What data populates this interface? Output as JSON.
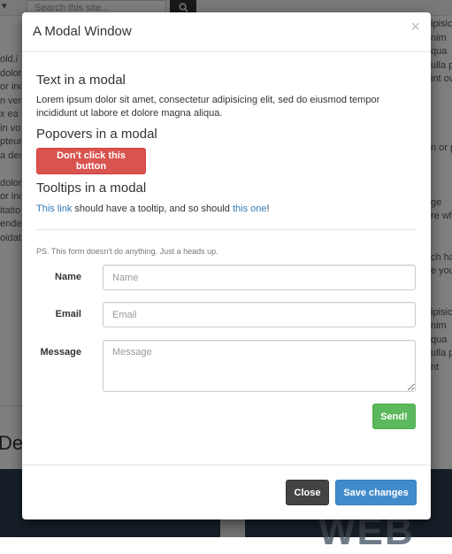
{
  "background": {
    "dropdown_caret": "▾",
    "search_placeholder": "Search this site...",
    "search_icon": "search-icon",
    "left_fragments": [
      "dolor",
      "or inc",
      "n veni",
      "x ea",
      "in vol",
      "pteur",
      "a des",
      "",
      "dolor",
      "or inc",
      "itatio",
      "ender",
      "oidat"
    ],
    "left_label": "old.i",
    "right_fragments": [
      "ipisic",
      "nim",
      "qua",
      "ulla p",
      "int ov",
      "",
      "",
      "",
      "",
      "n or p",
      "",
      "",
      "",
      "ge",
      "re whi",
      "",
      "",
      "ch hav",
      "e you",
      "",
      "",
      "ipisic",
      "nim",
      "qua",
      "ulla p",
      "nt"
    ],
    "desc_heading": "Des",
    "banner_text": "WEB"
  },
  "modal": {
    "title": "A Modal Window",
    "close_glyph": "×",
    "text_heading": "Text in a modal",
    "text_body": "Lorem ipsum dolor sit amet, consectetur adipisicing elit, sed do eiusmod tempor incididunt ut labore et dolore magna aliqua.",
    "popovers_heading": "Popovers in a modal",
    "danger_button": "Don't click this button",
    "tooltips_heading": "Tooltips in a modal",
    "tooltip_link1": "This link",
    "tooltip_mid": "should have a tooltip, and so should",
    "tooltip_link2": "this one",
    "tooltip_end": "!",
    "ps_note": "PS. This form doesn't do anything. Just a heads up.",
    "form": {
      "name_label": "Name",
      "name_placeholder": "Name",
      "email_label": "Email",
      "email_placeholder": "Email",
      "message_label": "Message",
      "message_placeholder": "Message",
      "send_button": "Send!"
    },
    "footer": {
      "close_button": "Close",
      "save_button": "Save changes"
    }
  },
  "colors": {
    "danger": "#d9534f",
    "success": "#5cb85c",
    "primary": "#428bca",
    "dark": "#444444",
    "link": "#337ab7"
  }
}
